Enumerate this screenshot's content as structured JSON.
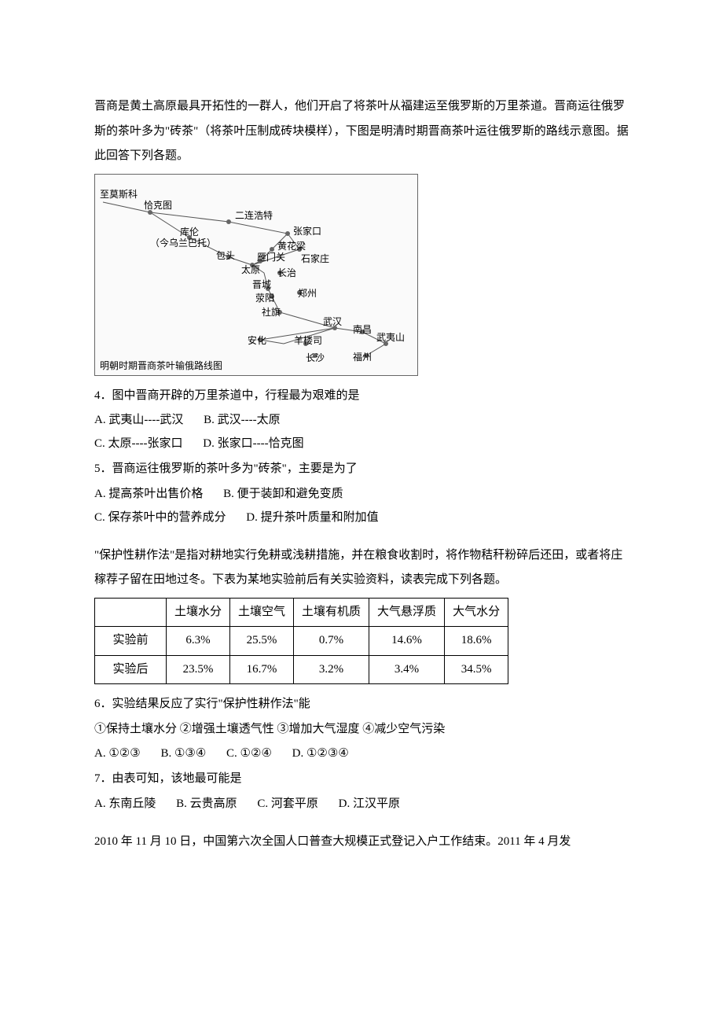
{
  "passage1": {
    "text": "晋商是黄土高原最具开拓性的一群人，他们开启了将茶叶从福建运至俄罗斯的万里茶道。晋商运往俄罗斯的茶叶多为\"砖茶\"（将茶叶压制成砖块模样），下图是明清时期晋商茶叶运往俄罗斯的路线示意图。据此回答下列各题。"
  },
  "map": {
    "title": "明朝时期晋商茶叶输俄路线图",
    "nodes": {
      "moscow": "至莫斯科",
      "qiaketu": "恰克图",
      "kulun": "库伦",
      "kulun_note": "（今乌兰巴托）",
      "erlian": "二连浩特",
      "baotou": "包头",
      "zhangjiakou": "张家口",
      "huanghualiang": "黄花梁",
      "yanmenguan": "雁门关",
      "shijiazhuang": "石家庄",
      "taiyuan": "太原",
      "changzhi": "长治",
      "jincheng": "晋城",
      "zhengzhou": "郑州",
      "xingyang": "荥阳",
      "sheqi": "社旗",
      "wuhan": "武汉",
      "anhua": "安化",
      "yanglou": "羊楼司",
      "changsha": "长沙",
      "nanchang": "南昌",
      "wuyishan": "武夷山",
      "fuzhou": "福州"
    }
  },
  "q4": {
    "stem": "4．图中晋商开辟的万里茶道中，行程最为艰难的是",
    "A": "A. 武夷山----武汉",
    "B": "B. 武汉----太原",
    "C": "C. 太原----张家口",
    "D": "D. 张家口----恰克图"
  },
  "q5": {
    "stem": "5．晋商运往俄罗斯的茶叶多为\"砖茶\"，主要是为了",
    "A": "A. 提高茶叶出售价格",
    "B": "B. 便于装卸和避免变质",
    "C": "C. 保存茶叶中的营养成分",
    "D": "D. 提升茶叶质量和附加值"
  },
  "passage2": {
    "text": "\"保护性耕作法\"是指对耕地实行免耕或浅耕措施，并在粮食收割时，将作物秸秆粉碎后还田，或者将庄稼荐子留在田地过冬。下表为某地实验前后有关实验资料，读表完成下列各题。"
  },
  "table": {
    "cols": [
      "",
      "土壤水分",
      "土壤空气",
      "土壤有机质",
      "大气悬浮质",
      "大气水分"
    ],
    "rows": [
      {
        "label": "实验前",
        "vals": [
          "6.3%",
          "25.5%",
          "0.7%",
          "14.6%",
          "18.6%"
        ]
      },
      {
        "label": "实验后",
        "vals": [
          "23.5%",
          "16.7%",
          "3.2%",
          "3.4%",
          "34.5%"
        ]
      }
    ]
  },
  "chart_data": {
    "type": "table",
    "title": "保护性耕作法实验前后对比",
    "columns": [
      "土壤水分",
      "土壤空气",
      "土壤有机质",
      "大气悬浮质",
      "大气水分"
    ],
    "rows": [
      {
        "name": "实验前",
        "values": [
          6.3,
          25.5,
          0.7,
          14.6,
          18.6
        ]
      },
      {
        "name": "实验后",
        "values": [
          23.5,
          16.7,
          3.2,
          3.4,
          34.5
        ]
      }
    ],
    "unit": "%"
  },
  "q6": {
    "stem": "6．实验结果反应了实行\"保护性耕作法\"能",
    "items": "①保持土壤水分 ②增强土壤透气性    ③增加大气湿度 ④减少空气污染",
    "A": "A. ①②③",
    "B": "B. ①③④",
    "C": "C. ①②④",
    "D": "D. ①②③④"
  },
  "q7": {
    "stem": "7．由表可知，该地最可能是",
    "A": "A. 东南丘陵",
    "B": "B. 云贵高原",
    "C": "C. 河套平原",
    "D": "D. 江汉平原"
  },
  "passage3": {
    "text": "2010 年 11 月 10 日，中国第六次全国人口普查大规模正式登记入户工作结束。2011 年 4 月发"
  }
}
